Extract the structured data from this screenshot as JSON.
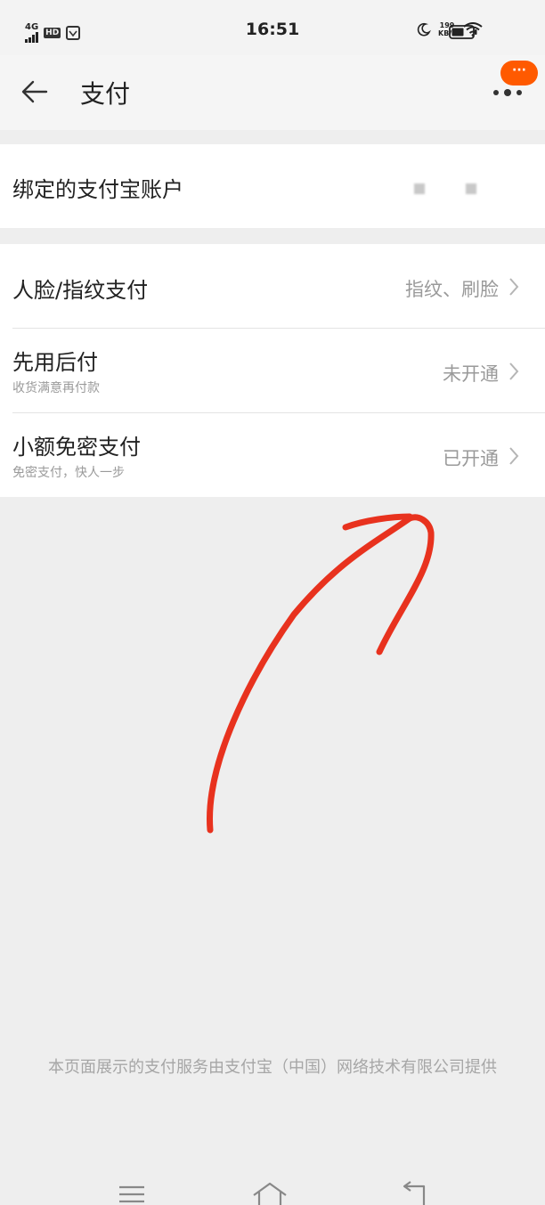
{
  "status_bar": {
    "network": "4G",
    "hd": "HD",
    "time": "16:51",
    "speed_value": "199",
    "speed_unit": "KB/s"
  },
  "header": {
    "title": "支付",
    "badge": "···"
  },
  "account": {
    "label": "绑定的支付宝账户"
  },
  "settings": [
    {
      "title": "人脸/指纹支付",
      "subtitle": "",
      "value": "指纹、刷脸"
    },
    {
      "title": "先用后付",
      "subtitle": "收货满意再付款",
      "value": "未开通"
    },
    {
      "title": "小额免密支付",
      "subtitle": "免密支付，快人一步",
      "value": "已开通"
    }
  ],
  "footer": {
    "text": "本页面展示的支付服务由支付宝（中国）网络技术有限公司提供"
  },
  "colors": {
    "accent": "#ff5a00",
    "annotation": "#e8321e"
  },
  "icons": [
    "back-arrow-icon",
    "more-icon",
    "chevron-right-icon",
    "menu-icon",
    "home-icon",
    "back-icon",
    "wifi-icon",
    "moon-icon",
    "battery-icon"
  ]
}
